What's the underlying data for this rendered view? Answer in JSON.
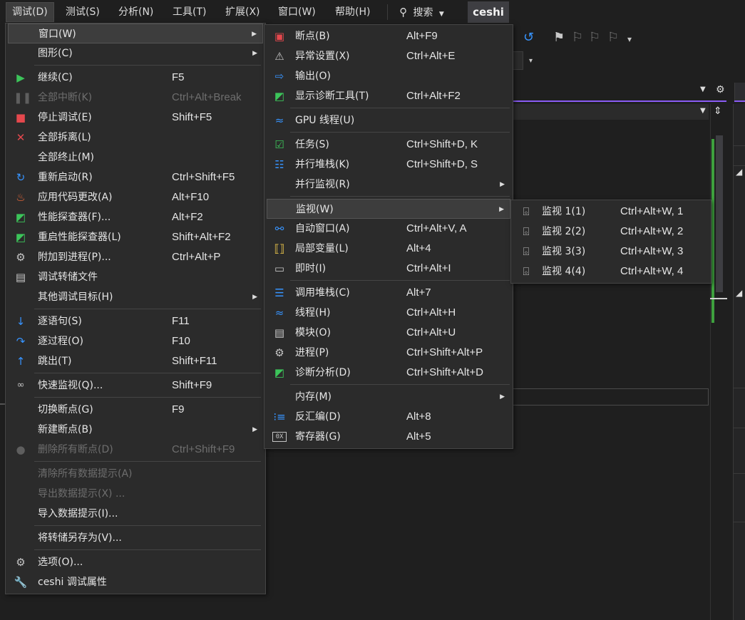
{
  "menubar": {
    "items": [
      "调试(D)",
      "测试(S)",
      "分析(N)",
      "工具(T)",
      "扩展(X)",
      "窗口(W)",
      "帮助(H)"
    ],
    "search_label": "搜索",
    "solution_name": "ceshi"
  },
  "debug_menu": {
    "items": [
      {
        "label": "窗口(W)",
        "shortcut": "",
        "icon": "none",
        "submenu": true
      },
      {
        "label": "图形(C)",
        "shortcut": "",
        "icon": "none",
        "submenu": true
      },
      {
        "label": "继续(C)",
        "shortcut": "F5",
        "icon": "play-icon"
      },
      {
        "label": "全部中断(K)",
        "shortcut": "Ctrl+Alt+Break",
        "icon": "pause-icon",
        "disabled": true
      },
      {
        "label": "停止调试(E)",
        "shortcut": "Shift+F5",
        "icon": "stop-icon"
      },
      {
        "label": "全部拆离(L)",
        "shortcut": "",
        "icon": "detach-icon"
      },
      {
        "label": "全部终止(M)",
        "shortcut": "",
        "icon": "none"
      },
      {
        "label": "重新启动(R)",
        "shortcut": "Ctrl+Shift+F5",
        "icon": "restart-icon"
      },
      {
        "label": "应用代码更改(A)",
        "shortcut": "Alt+F10",
        "icon": "hot-reload-icon"
      },
      {
        "label": "性能探查器(F)...",
        "shortcut": "Alt+F2",
        "icon": "profiler-icon"
      },
      {
        "label": "重启性能探查器(L)",
        "shortcut": "Shift+Alt+F2",
        "icon": "profiler-restart-icon"
      },
      {
        "label": "附加到进程(P)...",
        "shortcut": "Ctrl+Alt+P",
        "icon": "attach-process-icon"
      },
      {
        "label": "调试转储文件",
        "shortcut": "",
        "icon": "dump-file-icon"
      },
      {
        "label": "其他调试目标(H)",
        "shortcut": "",
        "icon": "none",
        "submenu": true
      },
      {
        "label": "逐语句(S)",
        "shortcut": "F11",
        "icon": "step-into-icon"
      },
      {
        "label": "逐过程(O)",
        "shortcut": "F10",
        "icon": "step-over-icon"
      },
      {
        "label": "跳出(T)",
        "shortcut": "Shift+F11",
        "icon": "step-out-icon"
      },
      {
        "label": "快速监视(Q)...",
        "shortcut": "Shift+F9",
        "icon": "quick-watch-icon"
      },
      {
        "label": "切换断点(G)",
        "shortcut": "F9",
        "icon": "none"
      },
      {
        "label": "新建断点(B)",
        "shortcut": "",
        "icon": "none",
        "submenu": true
      },
      {
        "label": "删除所有断点(D)",
        "shortcut": "Ctrl+Shift+F9",
        "icon": "delete-breakpoints-icon",
        "disabled": true
      },
      {
        "label": "清除所有数据提示(A)",
        "shortcut": "",
        "icon": "none",
        "disabled": true
      },
      {
        "label": "导出数据提示(X) ...",
        "shortcut": "",
        "icon": "none",
        "disabled": true
      },
      {
        "label": "导入数据提示(I)...",
        "shortcut": "",
        "icon": "none"
      },
      {
        "label": "将转储另存为(V)...",
        "shortcut": "",
        "icon": "none"
      },
      {
        "label": "选项(O)...",
        "shortcut": "",
        "icon": "gear-icon"
      },
      {
        "label": "ceshi 调试属性",
        "shortcut": "",
        "icon": "wrench-icon"
      }
    ]
  },
  "windows_submenu": {
    "items": [
      {
        "label": "断点(B)",
        "shortcut": "Alt+F9",
        "icon": "breakpoints-window-icon"
      },
      {
        "label": "异常设置(X)",
        "shortcut": "Ctrl+Alt+E",
        "icon": "exception-settings-icon"
      },
      {
        "label": "输出(O)",
        "shortcut": "",
        "icon": "output-icon"
      },
      {
        "label": "显示诊断工具(T)",
        "shortcut": "Ctrl+Alt+F2",
        "icon": "diagnostic-tools-icon"
      },
      {
        "label": "GPU 线程(U)",
        "shortcut": "",
        "icon": "gpu-threads-icon"
      },
      {
        "label": "任务(S)",
        "shortcut": "Ctrl+Shift+D, K",
        "icon": "tasks-icon"
      },
      {
        "label": "并行堆栈(K)",
        "shortcut": "Ctrl+Shift+D, S",
        "icon": "parallel-stacks-icon"
      },
      {
        "label": "并行监视(R)",
        "shortcut": "",
        "icon": "none",
        "submenu": true
      },
      {
        "label": "监视(W)",
        "shortcut": "",
        "icon": "none",
        "submenu": true
      },
      {
        "label": "自动窗口(A)",
        "shortcut": "Ctrl+Alt+V, A",
        "icon": "autos-icon"
      },
      {
        "label": "局部变量(L)",
        "shortcut": "Alt+4",
        "icon": "locals-icon"
      },
      {
        "label": "即时(I)",
        "shortcut": "Ctrl+Alt+I",
        "icon": "immediate-icon"
      },
      {
        "label": "调用堆栈(C)",
        "shortcut": "Alt+7",
        "icon": "call-stack-icon"
      },
      {
        "label": "线程(H)",
        "shortcut": "Ctrl+Alt+H",
        "icon": "threads-icon"
      },
      {
        "label": "模块(O)",
        "shortcut": "Ctrl+Alt+U",
        "icon": "modules-icon"
      },
      {
        "label": "进程(P)",
        "shortcut": "Ctrl+Shift+Alt+P",
        "icon": "processes-icon"
      },
      {
        "label": "诊断分析(D)",
        "shortcut": "Ctrl+Shift+Alt+D",
        "icon": "diagnostic-analysis-icon"
      },
      {
        "label": "内存(M)",
        "shortcut": "",
        "icon": "none",
        "submenu": true
      },
      {
        "label": "反汇编(D)",
        "shortcut": "Alt+8",
        "icon": "disassembly-icon"
      },
      {
        "label": "寄存器(G)",
        "shortcut": "Alt+5",
        "icon": "registers-icon"
      }
    ]
  },
  "watch_submenu": {
    "items": [
      {
        "label": "监视 1(1)",
        "shortcut": "Ctrl+Alt+W, 1",
        "icon": "watch-window-icon"
      },
      {
        "label": "监视 2(2)",
        "shortcut": "Ctrl+Alt+W, 2",
        "icon": "watch-window-icon"
      },
      {
        "label": "监视 3(3)",
        "shortcut": "Ctrl+Alt+W, 3",
        "icon": "watch-window-icon"
      },
      {
        "label": "监视 4(4)",
        "shortcut": "Ctrl+Alt+W, 4",
        "icon": "watch-window-icon"
      }
    ]
  },
  "colors": {
    "menu_bg": "#2b2b2b",
    "highlight_bg": "#3d3d3d",
    "accent_purple": "#8a5cf5",
    "green": "#3cc45a",
    "red": "#e5484d",
    "blue": "#3794ff"
  }
}
